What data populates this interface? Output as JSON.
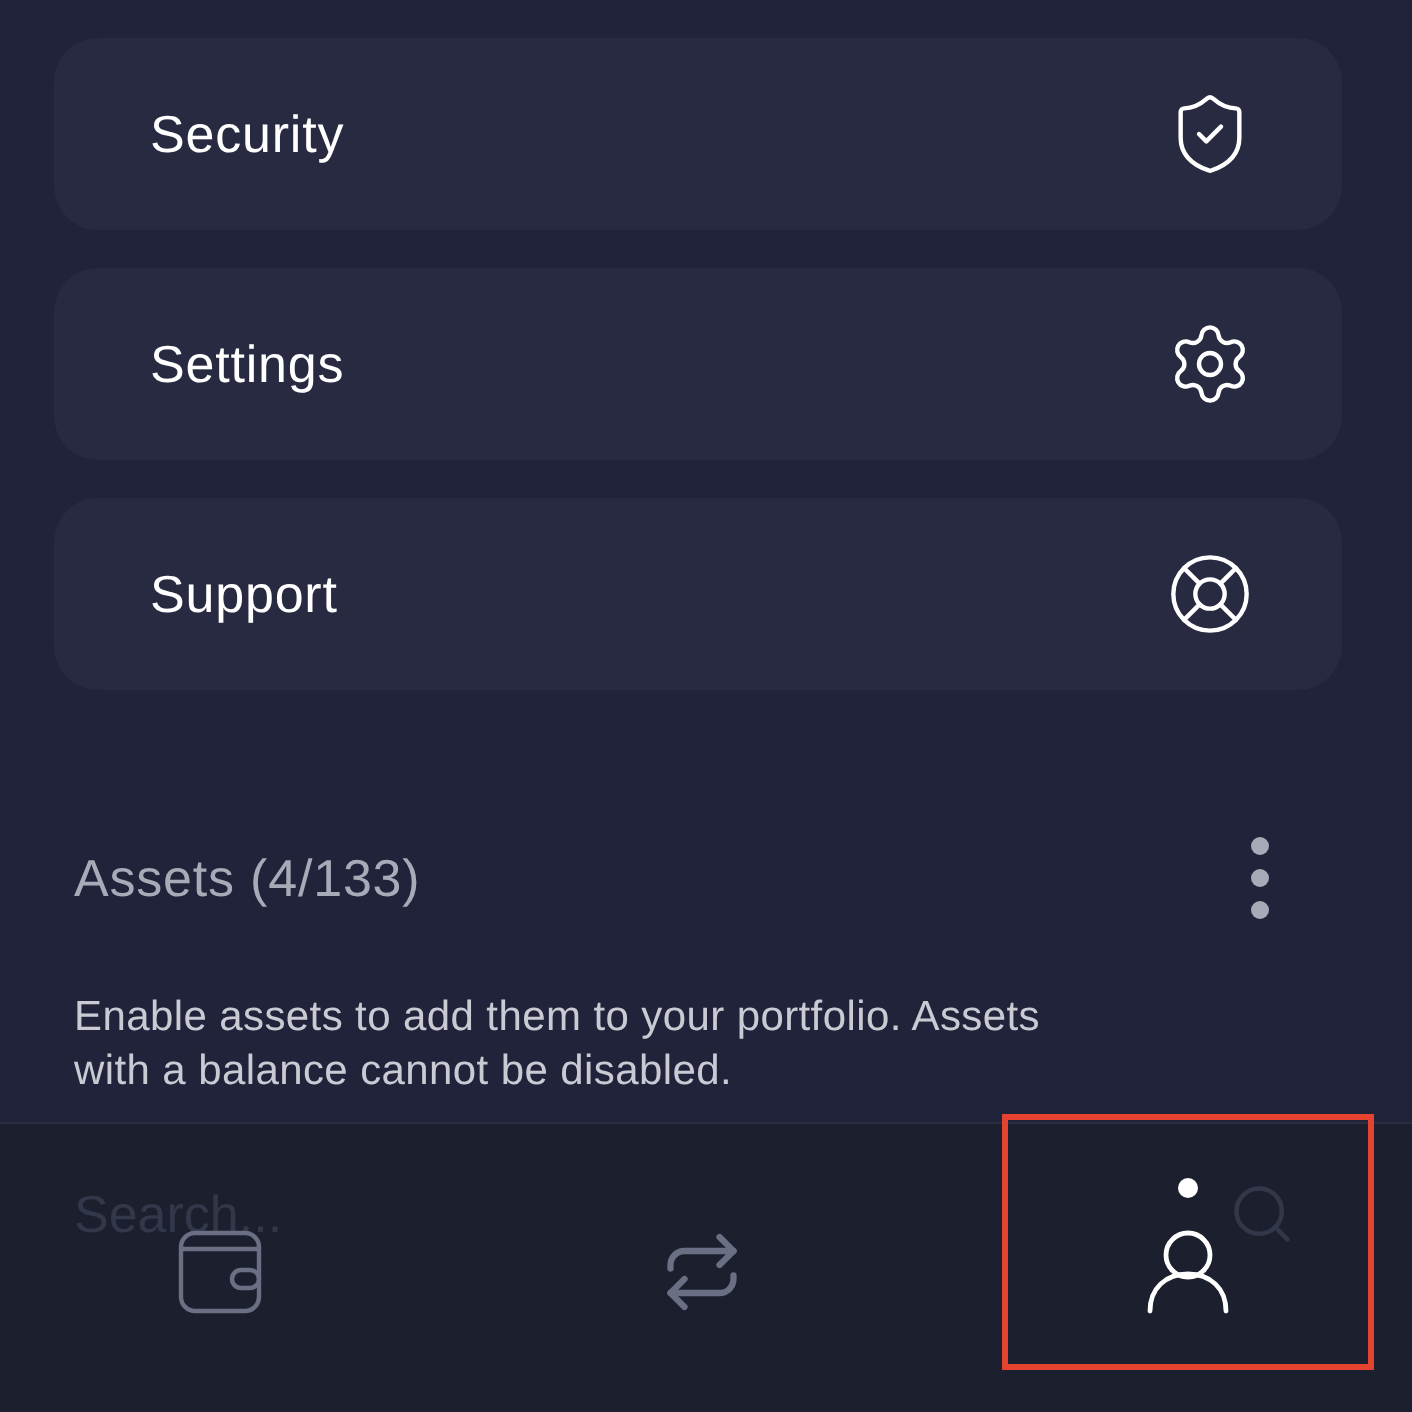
{
  "menu": [
    {
      "kind": "security",
      "label": "Security"
    },
    {
      "kind": "settings",
      "label": "Settings"
    },
    {
      "kind": "support",
      "label": "Support"
    }
  ],
  "assets": {
    "title": "Assets (4/133)",
    "description": "Enable assets to add them to your portfolio. Assets with a balance cannot be disabled."
  },
  "search": {
    "placeholder": "Search..."
  },
  "tabs": [
    {
      "kind": "wallet",
      "selected": false,
      "highlighted": false
    },
    {
      "kind": "transfer",
      "selected": false,
      "highlighted": false
    },
    {
      "kind": "profile",
      "selected": true,
      "highlighted": true
    }
  ]
}
